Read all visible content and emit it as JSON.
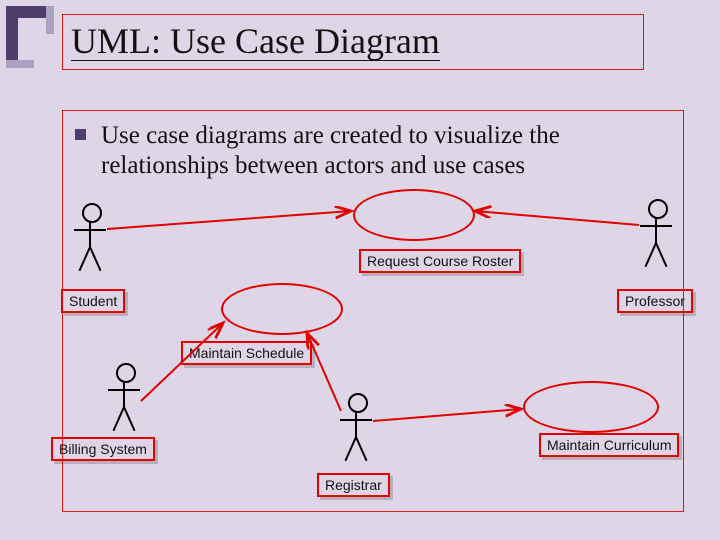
{
  "slide": {
    "title": "UML: Use Case Diagram",
    "bullet_text": "Use case diagrams are created to visualize the relationships between actors and use cases"
  },
  "actors": {
    "student": "Student",
    "professor": "Professor",
    "billing_system": "Billing System",
    "registrar": "Registrar"
  },
  "usecases": {
    "request_course_roster": "Request Course Roster",
    "maintain_schedule": "Maintain Schedule",
    "maintain_curriculum": "Maintain Curriculum"
  },
  "diagram": {
    "ellipses": [
      "register-for-courses-ellipse",
      "request-course-roster-ellipse",
      "maintain-schedule-ellipse",
      "maintain-curriculum-ellipse"
    ],
    "associations": [
      {
        "from": "student",
        "to": "register-for-courses"
      },
      {
        "from": "professor",
        "to": "request-course-roster"
      },
      {
        "from": "billing-system",
        "to": "maintain-schedule"
      },
      {
        "from": "registrar",
        "to": "maintain-schedule"
      },
      {
        "from": "registrar",
        "to": "maintain-curriculum"
      }
    ]
  },
  "colors": {
    "accent_red": "#e20000",
    "accent_purple": "#513c6e",
    "background": "#ded6e6"
  }
}
